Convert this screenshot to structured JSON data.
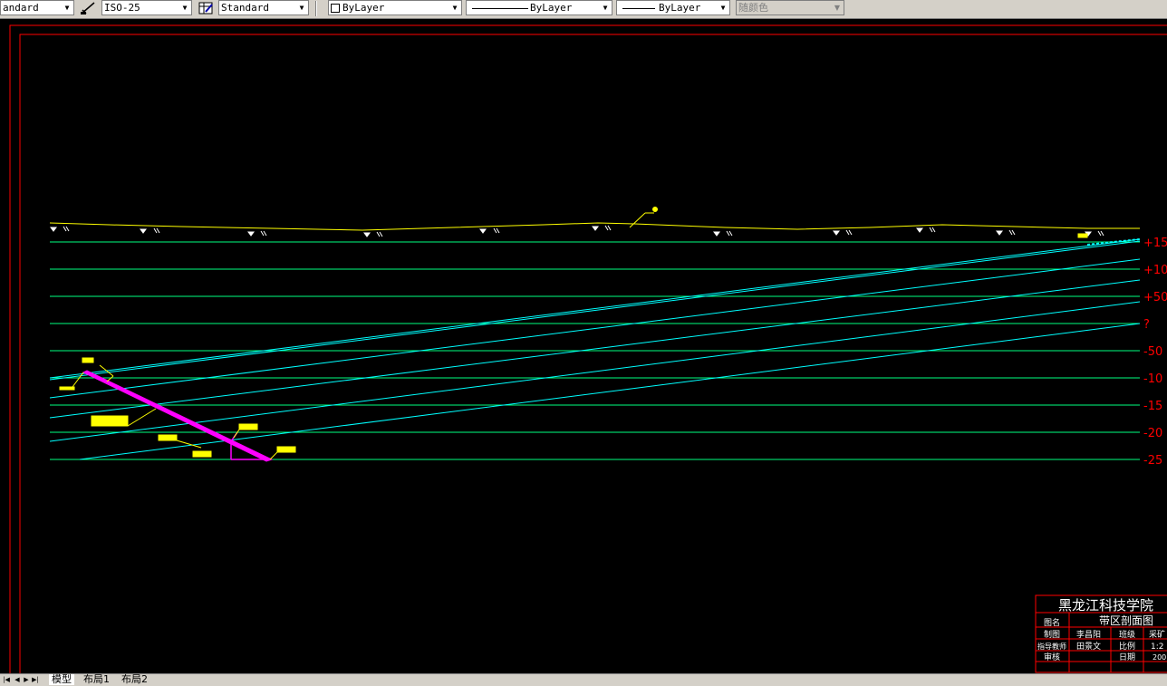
{
  "toolbar": {
    "text_style": "andard",
    "dim_style": "ISO-25",
    "table_style": "Standard",
    "layer": "ByLayer",
    "linetype": "ByLayer",
    "lineweight": "ByLayer",
    "color": "随颜色"
  },
  "drawing": {
    "level_labels": [
      "+15",
      "+10",
      "+50",
      "?",
      "-50",
      "-10",
      "-15",
      "-20",
      "-25"
    ],
    "colors": {
      "frame": "#ff0000",
      "surface": "#ffff00",
      "level_line": "#00ff7f",
      "seam": "#00ffff",
      "shaft": "#ff00ff",
      "label_block": "#ffff00"
    }
  },
  "title_block": {
    "school": "黑龙江科技学院",
    "title": "带区剖面图",
    "row1": [
      "图名",
      ""
    ],
    "row2": [
      "制图",
      "李昌阳",
      "班级",
      "采矿"
    ],
    "row3": [
      "指导教师",
      "田景文",
      "比例",
      "1:2"
    ],
    "row4": [
      "审核",
      "",
      "日期",
      "200"
    ]
  },
  "tabs": {
    "model": "模型",
    "layout1": "布局1",
    "layout2": "布局2"
  }
}
